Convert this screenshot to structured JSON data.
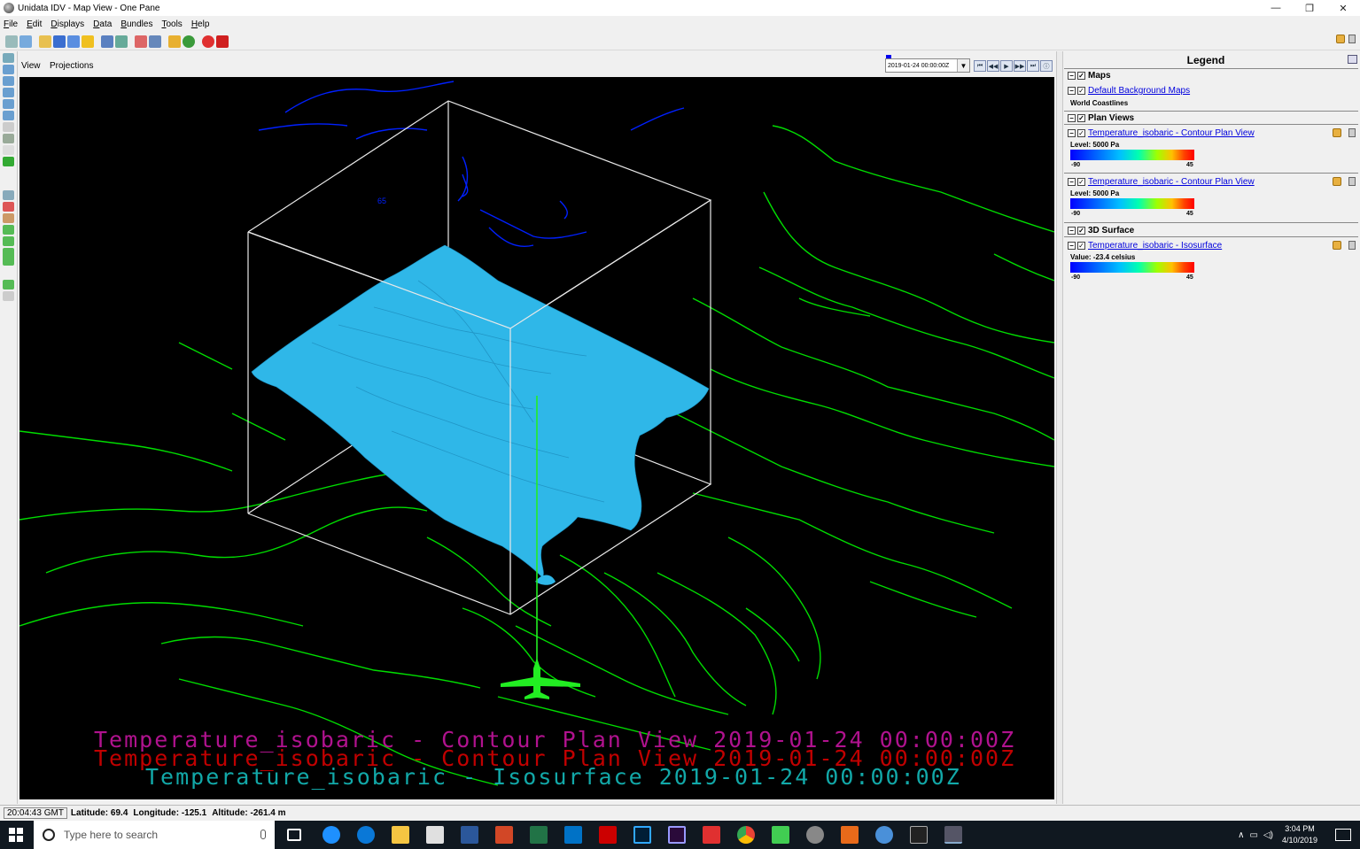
{
  "window": {
    "title": "Unidata IDV - Map View - One Pane",
    "controls": [
      "—",
      "❐",
      "✕"
    ]
  },
  "menu": [
    "File",
    "Edit",
    "Displays",
    "Data",
    "Bundles",
    "Tools",
    "Help"
  ],
  "view_header": {
    "tabs": [
      "View",
      "Projections"
    ],
    "time_value": "2019-01-24 00:00:00Z",
    "anim_buttons": [
      "⏮",
      "◀◀",
      "▶",
      "▶▶",
      "⏭",
      "ⓘ"
    ]
  },
  "map": {
    "overlay_lines": [
      {
        "text": "Temperature_isobaric - Contour Plan View 2019-01-24 00:00:00Z",
        "color": "#b0128e"
      },
      {
        "text": "Temperature_isobaric - Contour Plan View 2019-01-24 00:00:00Z",
        "color": "#c00000"
      },
      {
        "text": "Temperature_isobaric - Isosurface 2019-01-24 00:00:00Z",
        "color": "#12a8a8"
      }
    ],
    "label_65": "65",
    "colors": {
      "coastline": "#00dd00",
      "isosurface": "#2fb7e8",
      "contour": "#0020ff",
      "box": "#e8e8e8"
    }
  },
  "legend": {
    "title": "Legend",
    "categories": [
      {
        "name": "Maps",
        "entries": [
          {
            "link": "Default Background Maps",
            "sub": "World Coastlines"
          }
        ]
      },
      {
        "name": "Plan Views",
        "entries": [
          {
            "link": "Temperature_isobaric - Contour Plan View",
            "sub": "Level: 5000 Pa",
            "min": "-90",
            "max": "45"
          },
          {
            "link": "Temperature_isobaric - Contour Plan View",
            "sub": "Level: 5000 Pa",
            "min": "-90",
            "max": "45"
          }
        ]
      },
      {
        "name": "3D Surface",
        "entries": [
          {
            "link": "Temperature_isobaric - Isosurface",
            "sub": "Value: -23.4 celsius",
            "min": "-90",
            "max": "45"
          }
        ]
      }
    ]
  },
  "status": {
    "clock": "20:04:43 GMT",
    "latitude": "Latitude:  69.4",
    "longitude": "Longitude: -125.1",
    "altitude": "Altitude: -261.4 m"
  },
  "taskbar": {
    "search_placeholder": "Type here to search",
    "time": "3:04 PM",
    "date": "4/10/2019"
  }
}
